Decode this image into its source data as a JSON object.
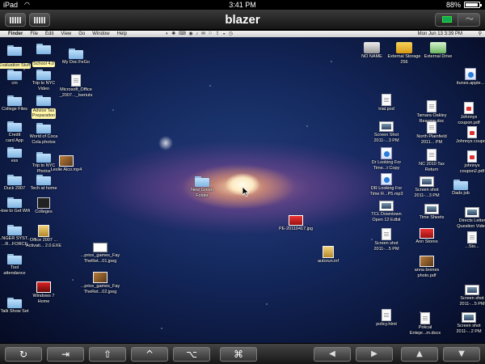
{
  "status_bar": {
    "carrier": "iPad",
    "time": "3:41 PM",
    "battery": "88%"
  },
  "app": {
    "title": "blazer"
  },
  "mac_menu": {
    "apple": "",
    "items": [
      "Finder",
      "File",
      "Edit",
      "View",
      "Go",
      "Window",
      "Help"
    ],
    "datetime": "Mon Jun 13  3:39 PM"
  },
  "desktop": {
    "left_icons": [
      {
        "label": "Evaluation Stuff",
        "kind": "folder",
        "selected": true
      },
      {
        "label": "School 4.0",
        "kind": "folder",
        "selected": true
      },
      {
        "label": "My Doc:FeGo",
        "kind": "folder"
      },
      {
        "label": "cm",
        "kind": "folder"
      },
      {
        "label": "Trip to NYC\nVideo",
        "kind": "folder"
      },
      {
        "label": "Microsoft_Office\n_2007..._Iseriuts",
        "kind": "doc"
      },
      {
        "label": "College Files",
        "kind": "folder"
      },
      {
        "label": "Advice Tax\nPreparation",
        "kind": "folder",
        "selected": true
      },
      {
        "label": "Credit\ncard App",
        "kind": "folder"
      },
      {
        "label": "World of Coca\nCola photos",
        "kind": "folder"
      },
      {
        "label": "ess",
        "kind": "folder"
      },
      {
        "label": "Trip to NYC\nPhotos",
        "kind": "folder"
      },
      {
        "label": "Leslie Alco.mp4",
        "kind": "photo"
      },
      {
        "label": "Duck 2007",
        "kind": "folder"
      },
      {
        "label": "Tech at home",
        "kind": "folder"
      },
      {
        "label": "How to Get Wifi",
        "kind": "folder"
      },
      {
        "label": "Colleges",
        "kind": "dark"
      },
      {
        "label": "...NGER SYST...\n...R...FORCE",
        "kind": "folder"
      },
      {
        "label": "Office 2007 ...\nActivati... 2.0.EXE",
        "kind": "gold"
      },
      {
        "label": "Tool\nattendance",
        "kind": "folder"
      },
      {
        "label": "...price_games_Fay\nTheRet...01.jpeg",
        "kind": "white"
      },
      {
        "label": "Windows 7\nHome",
        "kind": "win"
      },
      {
        "label": "...price_games_Fay\nTheRet...02.jpeg",
        "kind": "photo"
      },
      {
        "label": "Talk Show Set",
        "kind": "folder"
      }
    ],
    "center_icons": [
      {
        "label": "New Green\nFolder",
        "kind": "folder"
      },
      {
        "label": "PE-20110417.jpg",
        "kind": "red"
      },
      {
        "label": "autorun.inf",
        "kind": "gold"
      }
    ],
    "right_icons": [
      {
        "label": "NO NAME",
        "kind": "drive-grey"
      },
      {
        "label": "External Storage\n256",
        "kind": "drive"
      },
      {
        "label": "External Drive",
        "kind": "drive-green"
      },
      {
        "label": "itunes.apple...",
        "kind": "blue"
      },
      {
        "label": "trial.pod",
        "kind": "doc"
      },
      {
        "label": "Tamara Oakley\nResume.doc",
        "kind": "doc"
      },
      {
        "label": "Johnnys\ncoupon.pdf",
        "kind": "pdf"
      },
      {
        "label": "Screen Shot\n2011-...3 PM",
        "kind": "shot"
      },
      {
        "label": "North Plainfield\n2011... PM",
        "kind": "doc"
      },
      {
        "label": "Johnnys coupon",
        "kind": "pdf"
      },
      {
        "label": "Dr Looking For\nTime...t Copy",
        "kind": "blue"
      },
      {
        "label": "NC 2010 Tax\nReturn",
        "kind": "doc"
      },
      {
        "label": "johnnys\ncoupon2.pdf",
        "kind": "pdf"
      },
      {
        "label": "DR Looking For\nTime R...P5.mp3",
        "kind": "blue"
      },
      {
        "label": "Screen shot\n2011-...3 PM",
        "kind": "shot"
      },
      {
        "label": "Dads job",
        "kind": "folder"
      },
      {
        "label": "TCL Downtown\nOpen 12 Edbit",
        "kind": "shot"
      },
      {
        "label": "Time Sheets",
        "kind": "shot"
      },
      {
        "label": "Directs Letter\nQuestion Video",
        "kind": "shot"
      },
      {
        "label": "Screen shot\n2011-...5 PM",
        "kind": "doc"
      },
      {
        "label": "Ann Stores",
        "kind": "red"
      },
      {
        "label": "...Sto...",
        "kind": "doc"
      },
      {
        "label": "anna brenes\nphoto.pdf",
        "kind": "photo"
      },
      {
        "label": "Screen shot\n2011-...5 PM",
        "kind": "shot"
      },
      {
        "label": "policy.html",
        "kind": "doc"
      },
      {
        "label": "Pokcal\nEntepr...m.docx",
        "kind": "doc"
      },
      {
        "label": "Screen shot\n2011-...2 PM",
        "kind": "shot"
      }
    ]
  },
  "toolbar": {
    "undo": "↻",
    "tab": "⇥",
    "shift": "⇧",
    "ctrl": "^",
    "option": "⌥",
    "cmd": "⌘",
    "left": "◀",
    "right": "▶",
    "up": "▲",
    "down": "▼"
  }
}
